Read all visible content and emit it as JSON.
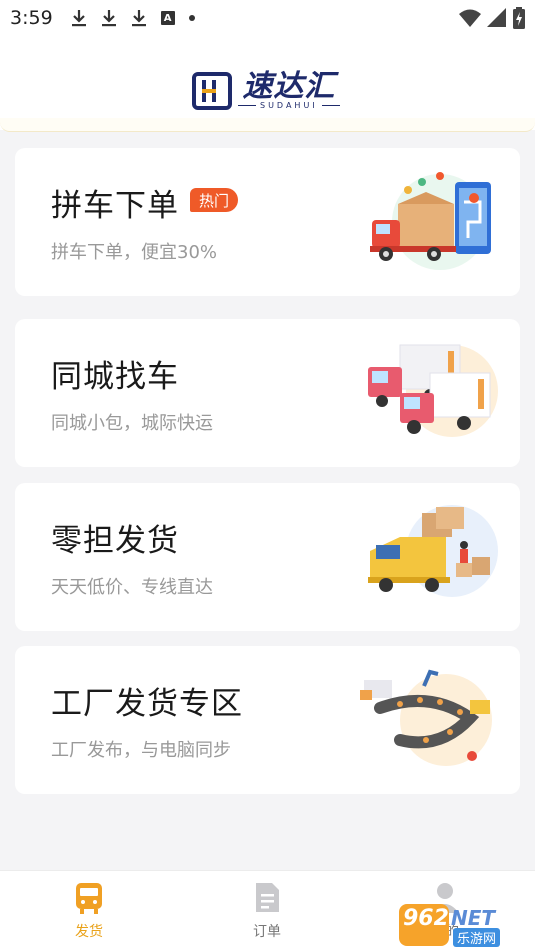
{
  "status_bar": {
    "time": "3:59",
    "icons": [
      "download-icon",
      "download-icon",
      "download-icon",
      "accessibility-a-icon",
      "notification-dot"
    ],
    "right_icons": [
      "wifi-icon",
      "signal-icon",
      "battery-icon"
    ]
  },
  "header": {
    "logo_cn": "速达汇",
    "logo_en": "SUDAHUI"
  },
  "cards": [
    {
      "title": "拼车下单",
      "badge": "热门",
      "subtitle": "拼车下单，便宜30%",
      "icon": "truck-map-illustration"
    },
    {
      "title": "同城找车",
      "subtitle": "同城小包，城际快运",
      "icon": "two-trucks-illustration"
    },
    {
      "title": "零担发货",
      "subtitle": "天天低价、专线直达",
      "icon": "truck-boxes-illustration"
    },
    {
      "title": "工厂发货专区",
      "subtitle": "工厂发布，与电脑同步",
      "icon": "factory-conveyor-illustration"
    }
  ],
  "tabbar": {
    "tabs": [
      {
        "label": "发货",
        "icon": "bus-icon",
        "active": true
      },
      {
        "label": "订单",
        "icon": "document-icon",
        "active": false
      },
      {
        "label": "我的",
        "icon": "person-icon",
        "active": false
      }
    ]
  },
  "watermark": {
    "number": "962",
    "net": "NET",
    "sub": "乐游网"
  },
  "colors": {
    "accent": "#e9a21a",
    "badge": "#ef5a28",
    "brand": "#1e2a6b",
    "background": "#f4f4f6"
  }
}
